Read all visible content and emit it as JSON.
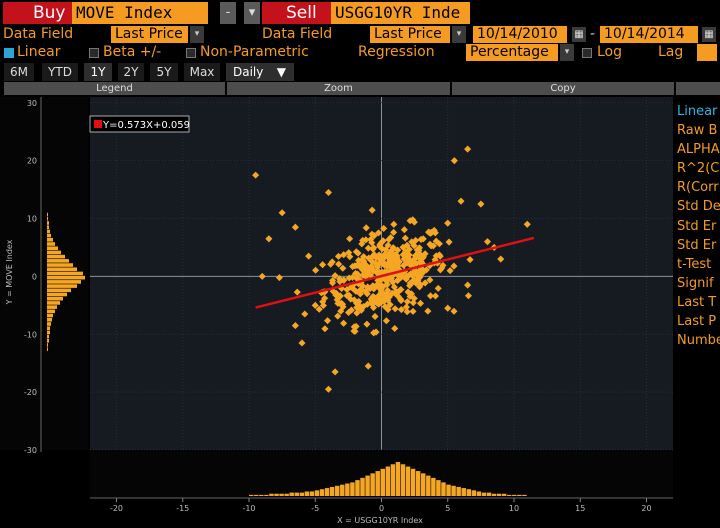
{
  "top": {
    "buy_label": "Buy",
    "buy_ticker": "MOVE Index",
    "minus_symbol": "-",
    "dropdown_symbol": "▾",
    "sell_label": "Sell",
    "sell_ticker": "USGG10YR Inde"
  },
  "row2": {
    "data_field_label_1": "Data Field",
    "data_field_value_1": "Last Price",
    "data_field_label_2": "Data Field",
    "data_field_value_2": "Last Price",
    "start_date": "10/14/2010",
    "date_sep": "-",
    "end_date": "10/14/2014"
  },
  "row3": {
    "linear_label": "Linear",
    "beta_label": "Beta +/-",
    "nonparam_label": "Non-Parametric",
    "regression_label": "Regression",
    "regression_value": "Percentage",
    "log_label": "Log",
    "lag_label": "Lag"
  },
  "periods": [
    "6M",
    "YTD",
    "1Y",
    "2Y",
    "5Y",
    "Max"
  ],
  "active_period": "1Y",
  "frequency": "Daily",
  "tabs": {
    "legend": "Legend",
    "zoom": "Zoom",
    "copy": "Copy"
  },
  "stats_panel": {
    "title": "Linear",
    "rows": [
      "Raw B",
      "ALPHA",
      "R^2(C",
      "R(Corr",
      "Std De",
      "Std Er",
      "Std Er",
      "t-Test",
      "Signif",
      "Last T",
      "Last P",
      "Numbe"
    ]
  },
  "chart_data": {
    "type": "scatter",
    "xlabel": "X = USGG10YR Index",
    "ylabel": "Y = MOVE Index",
    "xlim": [
      -22,
      22
    ],
    "ylim": [
      -30,
      31
    ],
    "xticks": [
      -20,
      -15,
      -10,
      -5,
      0,
      5,
      10,
      15,
      20
    ],
    "yticks": [
      -30,
      -20,
      -10,
      0,
      10,
      20,
      30
    ],
    "regression": {
      "equation": "Y=0.573X+0.059",
      "slope": 0.573,
      "intercept": 0.059,
      "x_range": [
        -9.5,
        11.5
      ]
    },
    "outliers": [
      [
        -9.5,
        17.5
      ],
      [
        -4,
        14.5
      ],
      [
        6.5,
        22
      ],
      [
        5.5,
        20
      ],
      [
        11,
        9
      ],
      [
        -4,
        -19.5
      ],
      [
        -3.5,
        -16.5
      ],
      [
        -1,
        -15.5
      ],
      [
        -6,
        -11.5
      ],
      [
        -6.5,
        -8.5
      ],
      [
        -9,
        0
      ],
      [
        -8.5,
        6.5
      ],
      [
        -7.5,
        11
      ],
      [
        -6.5,
        8.5
      ],
      [
        6,
        13
      ],
      [
        7.5,
        12.5
      ],
      [
        8,
        6
      ],
      [
        9,
        3
      ],
      [
        8.5,
        5
      ],
      [
        -5,
        -5
      ],
      [
        5,
        -5.5
      ],
      [
        3.5,
        -6
      ],
      [
        -2,
        -9.5
      ],
      [
        1,
        -9
      ],
      [
        -5.5,
        3.5
      ],
      [
        6.5,
        -1.5
      ]
    ],
    "colors": {
      "points": "#f5a623",
      "regression": "#e01010",
      "grid": "#2a3440",
      "plot_bg": "#161b22"
    }
  },
  "y_histogram": {
    "counts": [
      1,
      1,
      2,
      2,
      3,
      3,
      4,
      5,
      6,
      8,
      10,
      13,
      16,
      20,
      24,
      30,
      34,
      38,
      36,
      30,
      26,
      22,
      18,
      14,
      11,
      8,
      6,
      4,
      3,
      2,
      2,
      1,
      1
    ]
  },
  "x_histogram": {
    "counts": [
      1,
      1,
      1,
      1,
      2,
      2,
      2,
      2,
      3,
      3,
      3,
      4,
      4,
      5,
      6,
      7,
      8,
      9,
      10,
      11,
      12,
      14,
      16,
      18,
      20,
      22,
      24,
      26,
      28,
      30,
      28,
      26,
      24,
      22,
      20,
      18,
      16,
      14,
      12,
      10,
      9,
      8,
      7,
      6,
      5,
      4,
      3,
      3,
      2,
      2,
      2,
      1,
      1,
      1,
      1
    ]
  }
}
